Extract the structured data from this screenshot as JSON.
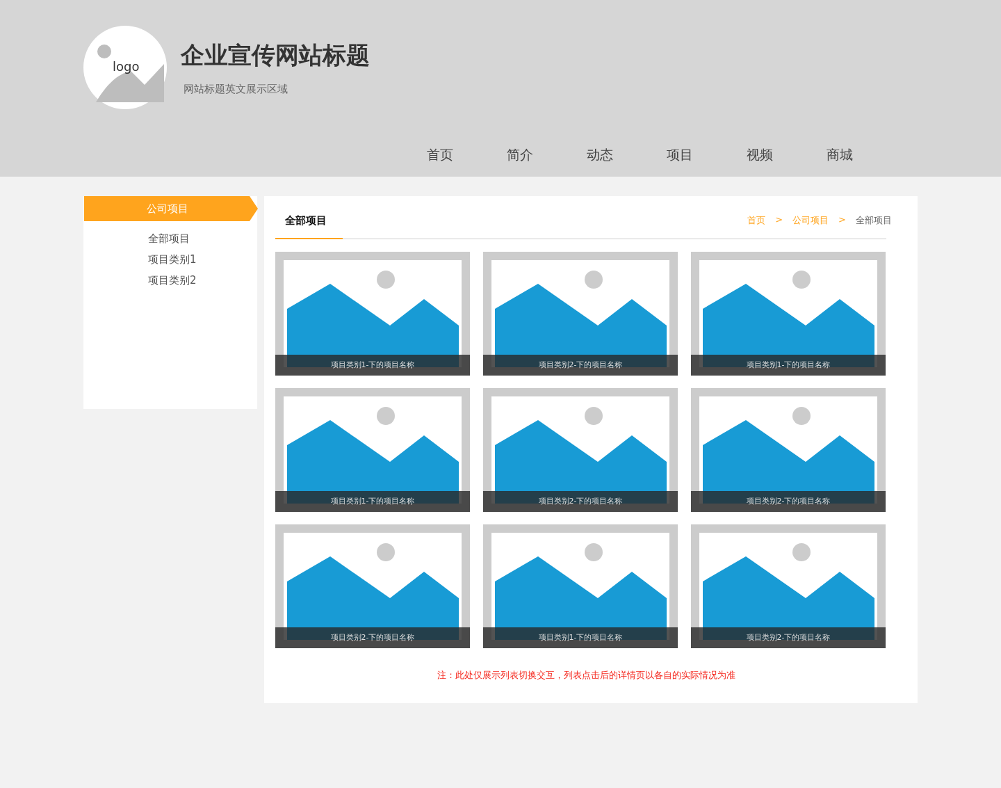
{
  "header": {
    "logo_text": "logo",
    "title": "企业宣传网站标题",
    "subtitle": "网站标题英文展示区域",
    "nav": [
      "首页",
      "简介",
      "动态",
      "项目",
      "视频",
      "商城"
    ]
  },
  "sidebar": {
    "title": "公司项目",
    "items": [
      "全部项目",
      "项目类别1",
      "项目类别2"
    ]
  },
  "content": {
    "tab": "全部项目",
    "breadcrumb": [
      {
        "label": "首页",
        "link": true
      },
      {
        "label": "公司项目",
        "link": true
      },
      {
        "label": "全部项目",
        "link": false
      }
    ],
    "breadcrumb_separator": ">",
    "cards": [
      {
        "caption": "项目类别1-下的项目名称"
      },
      {
        "caption": "项目类别2-下的项目名称"
      },
      {
        "caption": "项目类别1-下的项目名称"
      },
      {
        "caption": "项目类别1-下的项目名称"
      },
      {
        "caption": "项目类别2-下的项目名称"
      },
      {
        "caption": "项目类别2-下的项目名称"
      },
      {
        "caption": "项目类别2-下的项目名称"
      },
      {
        "caption": "项目类别1-下的项目名称"
      },
      {
        "caption": "项目类别2-下的项目名称"
      }
    ],
    "note": "注：此处仅展示列表切换交互，列表点击后的详情页以各自的实际情况为准"
  }
}
